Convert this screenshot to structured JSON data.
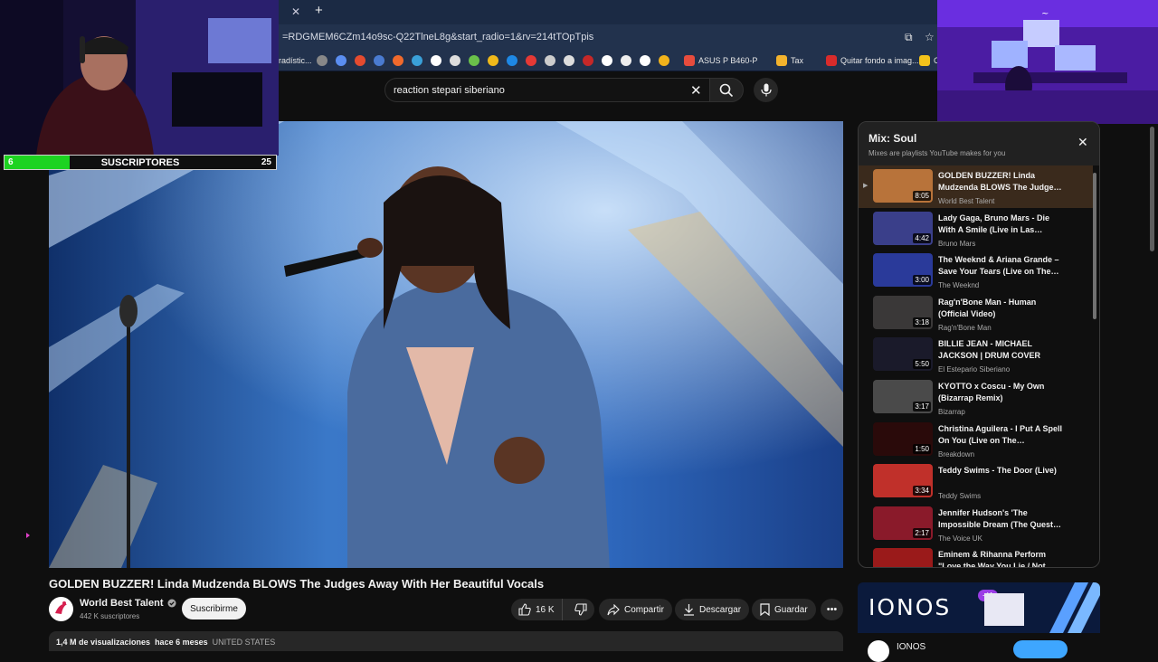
{
  "browser": {
    "url": "=RDGMEM6CZm14o9sc-Q22TlneL8g&start_radio=1&rv=214tTOpTpis",
    "tab_close": "✕",
    "new_tab": "+",
    "bookmarks": [
      {
        "label": "radístic...",
        "color": "#4a7bd0"
      },
      {
        "label": "ASUS P B460-P",
        "color": "#e84c3d"
      },
      {
        "label": "Tax",
        "color": "#f3b32d"
      },
      {
        "label": "Quitar fondo a imag...",
        "color": "#d92b2b"
      },
      {
        "label": "C",
        "color": "#f2c21b"
      }
    ]
  },
  "youtube": {
    "search_query": "reaction stepari siberiano",
    "clear_icon": "✕"
  },
  "overlay": {
    "subs_current": "6",
    "subs_label": "SUSCRIPTORES",
    "subs_goal": "25",
    "subs_progress": 0.24
  },
  "video": {
    "title": "GOLDEN BUZZER! Linda Mudzenda BLOWS The Judges Away With Her Beautiful Vocals",
    "channel": "World Best Talent",
    "subscribers": "442 K suscriptores",
    "subscribe_label": "Suscribirme",
    "likes": "16 K",
    "share_label": "Compartir",
    "download_label": "Descargar",
    "save_label": "Guardar",
    "more_label": "•••",
    "views": "1,4 M de visualizaciones",
    "age": "hace 6 meses",
    "location": "UNITED STATES"
  },
  "playlist": {
    "title": "Mix: Soul",
    "subtitle": "Mixes are playlists YouTube makes for you",
    "close_icon": "✕",
    "items": [
      {
        "title": "GOLDEN BUZZER! Linda Mudzenda BLOWS The Judge…",
        "channel": "World Best Talent",
        "duration": "8:05",
        "thumb": "#b8733a",
        "active": true
      },
      {
        "title": "Lady Gaga, Bruno Mars - Die With A Smile (Live in Las…",
        "channel": "Bruno Mars",
        "duration": "4:42",
        "thumb": "#3a3f8a"
      },
      {
        "title": "The Weeknd & Ariana Grande – Save Your Tears (Live on The…",
        "channel": "The Weeknd",
        "duration": "3:00",
        "thumb": "#2a3a9a"
      },
      {
        "title": "Rag'n'Bone Man - Human (Official Video)",
        "channel": "Rag'n'Bone Man",
        "duration": "3:18",
        "thumb": "#3a3838"
      },
      {
        "title": "BILLIE JEAN - MICHAEL JACKSON | DRUM COVER",
        "channel": "El Estepario Siberiano",
        "duration": "5:50",
        "thumb": "#1a1a2a"
      },
      {
        "title": "KYOTTO x Coscu - My Own (Bizarrap Remix)",
        "channel": "Bizarrap",
        "duration": "3:17",
        "thumb": "#4a4a4a"
      },
      {
        "title": "Christina Aguilera - I Put A Spell On You (Live on The…",
        "channel": "Breakdown",
        "duration": "1:50",
        "thumb": "#2a0a0a"
      },
      {
        "title": "Teddy Swims - The Door (Live)",
        "channel": "Teddy Swims",
        "duration": "3:34",
        "thumb": "#c0302a"
      },
      {
        "title": "Jennifer Hudson's 'The Impossible Dream (The Quest…",
        "channel": "The Voice UK",
        "duration": "2:17",
        "thumb": "#8a1a2a"
      },
      {
        "title": "Eminem & Rihanna Perform \"Love the Way You Lie / Not…",
        "channel": "",
        "duration": "",
        "thumb": "#9a1a1a"
      }
    ]
  },
  "ad": {
    "brand": "IONOS",
    "badge": "+IA",
    "advertiser": "IONOS"
  }
}
